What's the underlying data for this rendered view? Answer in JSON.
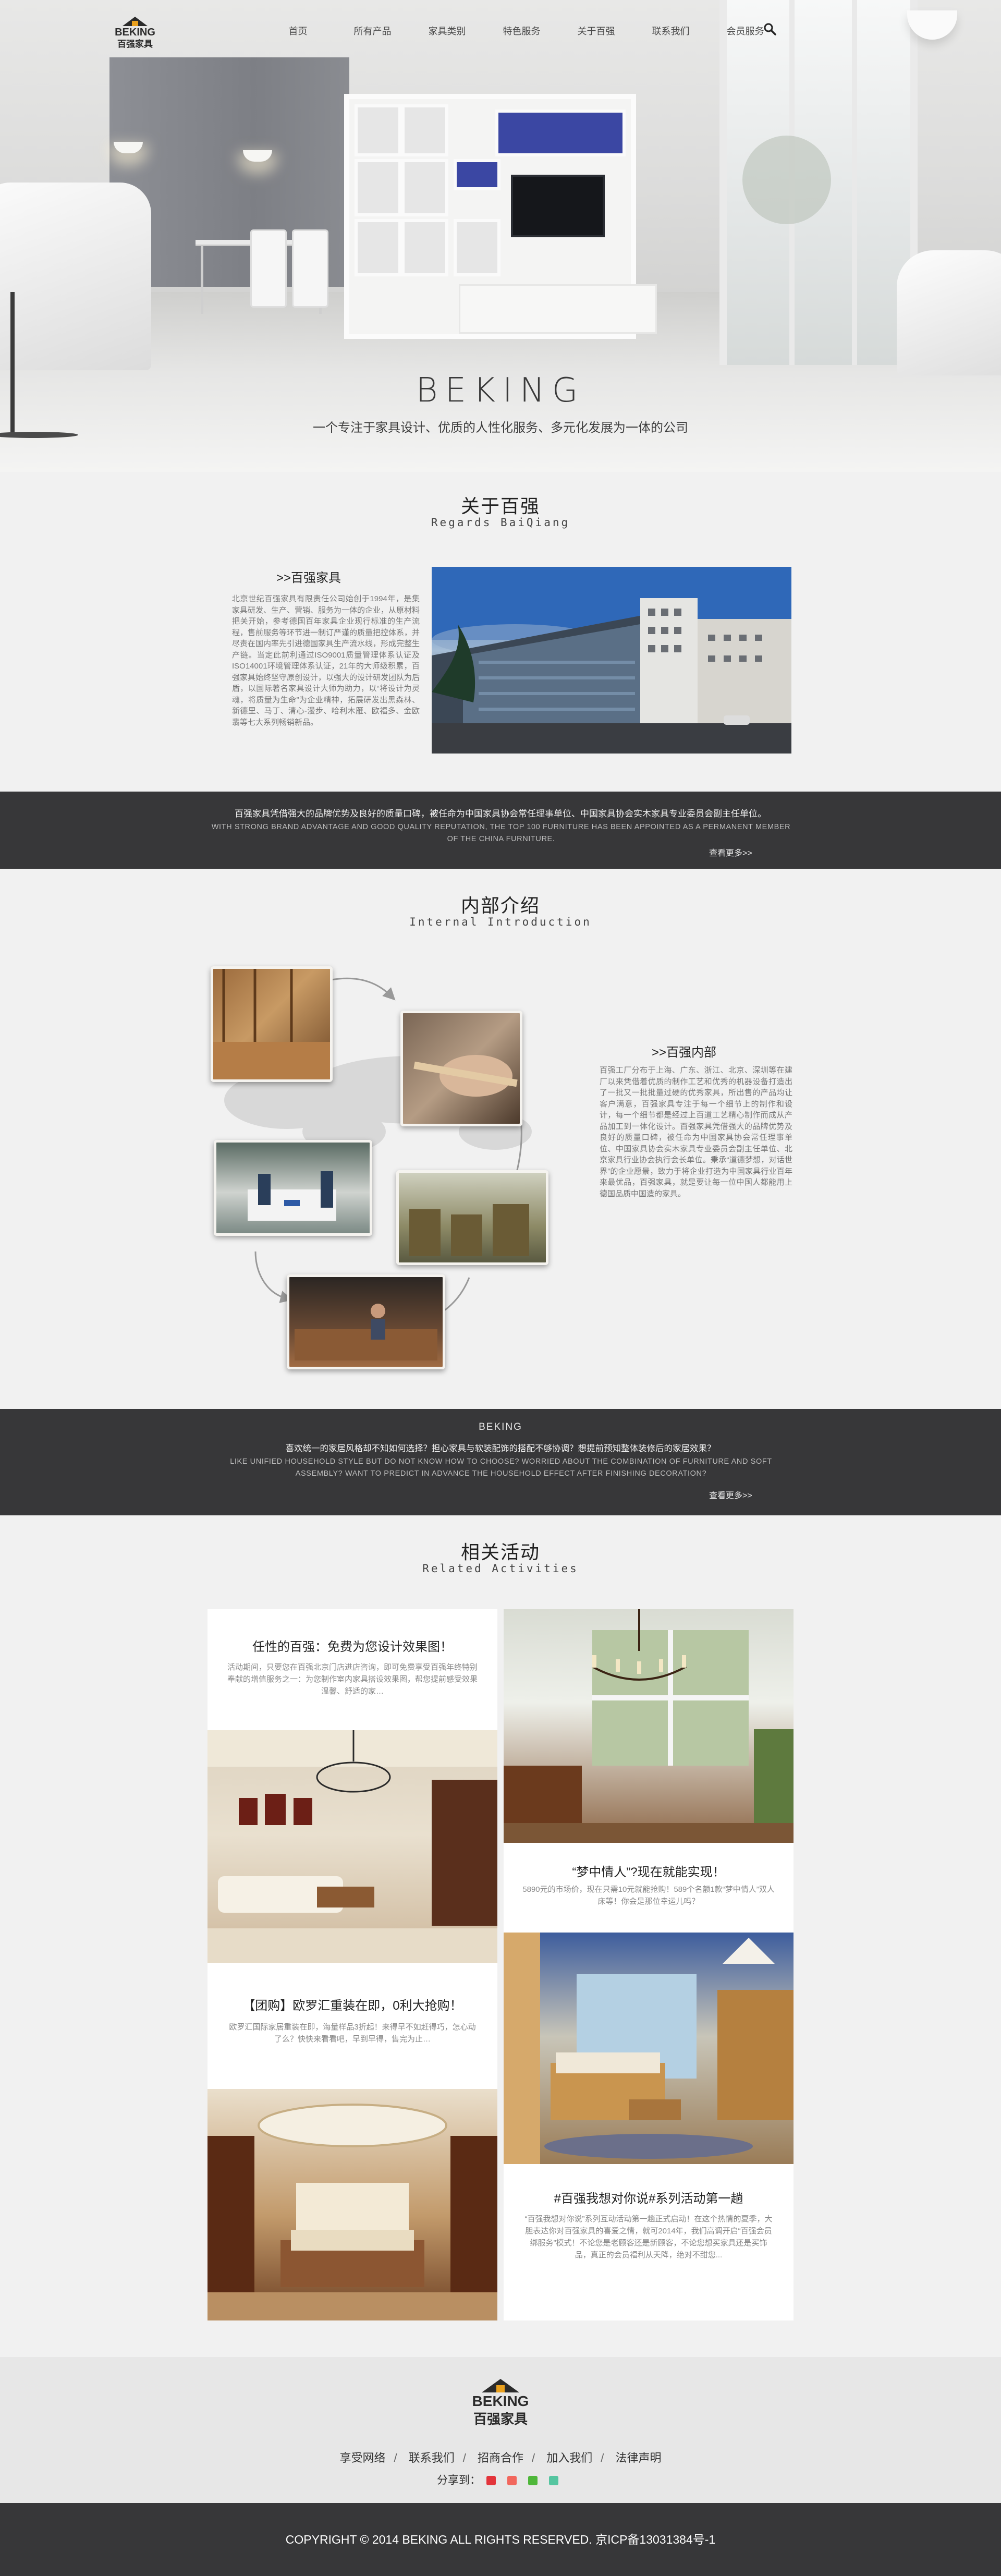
{
  "nav": {
    "logo_text_en": "BEKING",
    "logo_text_zh": "百强家具",
    "links": [
      "首页",
      "所有产品",
      "家具类别",
      "特色服务",
      "关于百强",
      "联系我们",
      "会员服务"
    ],
    "search_icon": "search-icon"
  },
  "hero": {
    "title": "BEKING",
    "subtitle": "一个专注于家具设计、优质的人性化服务、多元化发展为一体的公司"
  },
  "about": {
    "title": "关于百强",
    "subtitle": "Regards BaiQiang",
    "heading": ">>百强家具",
    "text": "北京世纪百强家具有限责任公司始创于1994年，是集家具研发、生产、营销、服务为一体的企业，从原材料把关开始，参考德国百年家具企业现行标准的生产流程，售前服务等环节进一制订严谨的质量把控体系，并尽责在国内率先引进德国家具生产流水线，形成完整生产链。当定此前利通过ISO9001质量管理体系认证及ISO14001环境管理体系认证，21年的大师级积累，百强家具始终坚守原创设计，以强大的设计研发团队为后盾，以国际著名家具设计大师为助力，以“将设计为灵魂，将质量为生命”为企业精神，拓展研发出黑森林、新德里、马丁、清心-漫步、哈利木雁、欧福多、金欧翡等七大系列畅销新品。"
  },
  "band1": {
    "zh": "百强家具凭借强大的品牌优势及良好的质量口碑，被任命为中国家具协会常任理事单位、中国家具协会实木家具专业委员会副主任单位。",
    "en": "WITH STRONG BRAND ADVANTAGE AND GOOD QUALITY REPUTATION, THE TOP 100 FURNITURE HAS BEEN APPOINTED AS A PERMANENT MEMBER OF THE CHINA FURNITURE.",
    "more": "查看更多>>"
  },
  "internal": {
    "title": "内部介绍",
    "subtitle": "Internal Introduction",
    "heading": ">>百强内部",
    "text": "百强工厂分布于上海、广东、浙江、北京、深圳等在建厂以来凭借着优质的制作工艺和优秀的机器设备打造出了一批又一批批量过硬的优秀家具，所出售的产品均让客户满意，百强家具专注于每一个细节上的制作和设计，每一个细节都是经过上百道工艺精心制作而成从产品加工到一体化设计。百强家具凭借强大的品牌优势及良好的质量口碑，被任命为中国家具协会常任理事单位、中国家具协会实木家具专业委员会副主任单位、北京家具行业协会执行会长单位。秉承“道德梦想，对话世界”的企业愿景，致力于将企业打造为中国家具行业百年来最优品，百强家具，就是要让每一位中国人都能用上德国品质中国造的家具。"
  },
  "band2": {
    "title": "BEKING",
    "zh": "喜欢统一的家居风格却不知如何选择？担心家具与软装配饰的搭配不够协调？想提前预知整体装修后的家居效果？",
    "en": "LIKE UNIFIED HOUSEHOLD STYLE BUT DO NOT KNOW HOW TO CHOOSE? WORRIED ABOUT THE COMBINATION OF FURNITURE AND SOFT ASSEMBLY? WANT TO PREDICT IN ADVANCE THE HOUSEHOLD EFFECT AFTER FINISHING DECORATION?",
    "more": "查看更多>>"
  },
  "activities": {
    "title": "相关活动",
    "subtitle": "Related Activities",
    "items": [
      {
        "title": "任性的百强：免费为您设计效果图！",
        "desc": "活动期间，只要您在百强北京门店进店咨询，即可免费享受百强年终特别奉献的增值服务之一：为您制作室内家具搭设效果图，帮您提前感受效果温馨、舒适的家…"
      },
      {
        "title": "“梦中情人”?现在就能实现！",
        "desc": "5890元的市场价，现在只需10元就能抢购！589个名额1款“梦中情人”双人床等！你会是那位幸运儿吗？"
      },
      {
        "title": "【团购】欧罗汇重装在即，0利大抢购！",
        "desc": "欧罗汇国际家居重装在即，海量样品3折起！来得早不如赶得巧，怎心动了么？快快来看看吧，早到早得，售完为止…"
      },
      {
        "title": "#百强我想对你说#系列活动第一趟",
        "desc": "“百强我想对你说”系列互动活动第一趟正式启动！在这个热情的夏季，大胆表达你对百强家具的喜爱之情，就可2014年，我们高调开启“百强会员绑服务”模式！不论您是老顾客还是新顾客，不论您想买家具还是买饰品，真正的会员福利从天降，绝对不甜您..."
      }
    ]
  },
  "footer": {
    "links": [
      "享受网络",
      "联系我们",
      "招商合作",
      "加入我们",
      "法律声明"
    ],
    "share_label": "分享到：",
    "share_colors": [
      "#e3343b",
      "#f2675d",
      "#4fb73a",
      "#55c5a0"
    ],
    "copyright": "COPYRIGHT © 2014 BEKING ALL RIGHTS RESERVED. 京ICP备13031384号-1"
  }
}
